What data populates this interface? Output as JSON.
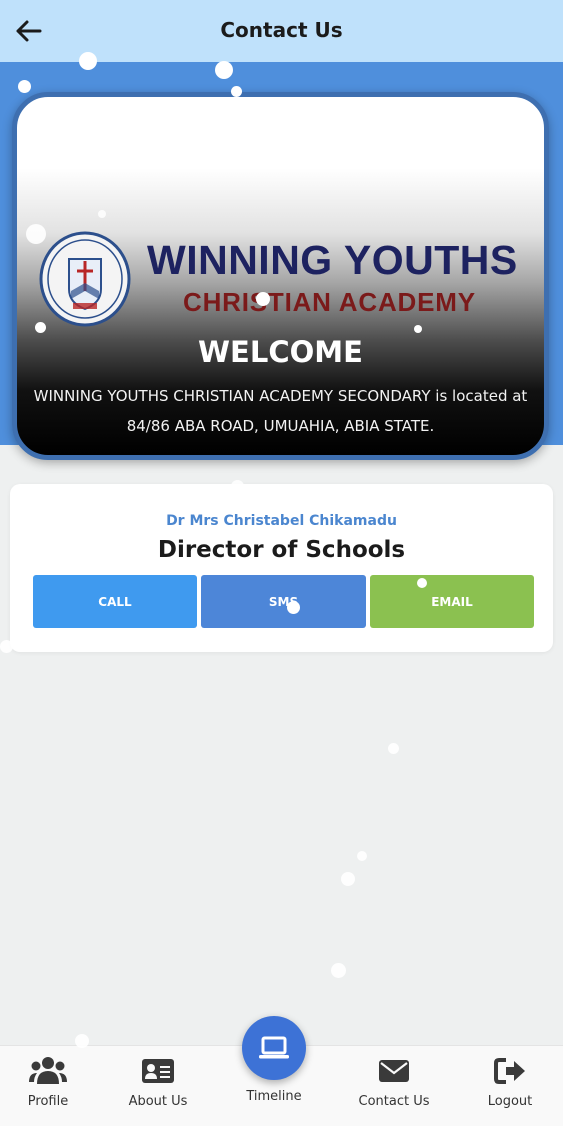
{
  "header": {
    "title": "Contact Us"
  },
  "hero": {
    "logo_line1": "WINNING YOUTHS",
    "logo_line2": "CHRISTIAN ACADEMY",
    "welcome_title": "WELCOME",
    "welcome_text": "WINNING YOUTHS CHRISTIAN ACADEMY SECONDARY is located at 84/86 ABA ROAD, UMUAHIA, ABIA STATE."
  },
  "contact": {
    "name": "Dr Mrs Christabel Chikamadu",
    "role": "Director of Schools",
    "buttons": {
      "call": "CALL",
      "sms": "SMS",
      "email": "EMAIL"
    }
  },
  "nav": {
    "items": [
      {
        "label": "Profile",
        "icon": "users-icon"
      },
      {
        "label": "About Us",
        "icon": "id-card-icon"
      },
      {
        "label": "Timeline",
        "icon": "laptop-icon"
      },
      {
        "label": "Contact Us",
        "icon": "envelope-icon"
      },
      {
        "label": "Logout",
        "icon": "sign-out-icon"
      }
    ]
  },
  "colors": {
    "appbar": "#bfe1fb",
    "band": "#4f8fdc",
    "call": "#3f9aef",
    "sms": "#4d86d8",
    "email": "#8bc150",
    "fab": "#3d72d6"
  }
}
